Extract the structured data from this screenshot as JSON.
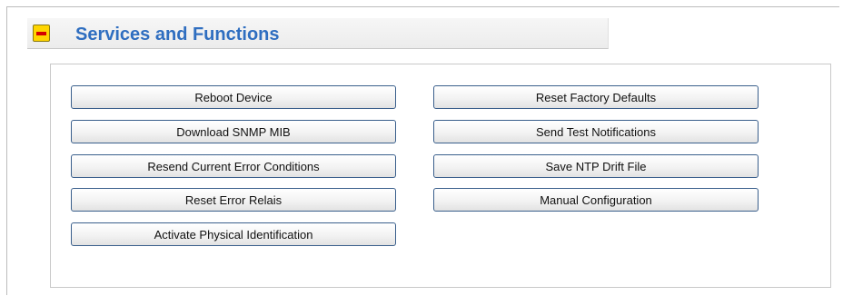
{
  "section": {
    "title": "Services and Functions",
    "collapse_icon": "minus-icon"
  },
  "buttons": {
    "left": [
      "Reboot Device",
      "Download SNMP MIB",
      "Resend Current Error Conditions",
      "Reset Error Relais",
      "Activate Physical Identification"
    ],
    "right": [
      "Reset Factory Defaults",
      "Send Test Notifications",
      "Save NTP Drift File",
      "Manual Configuration"
    ]
  },
  "colors": {
    "title": "#2f6ec0",
    "collapse_bg": "#ffd500",
    "collapse_minus": "#d40000",
    "button_border": "#3a5f8c"
  }
}
